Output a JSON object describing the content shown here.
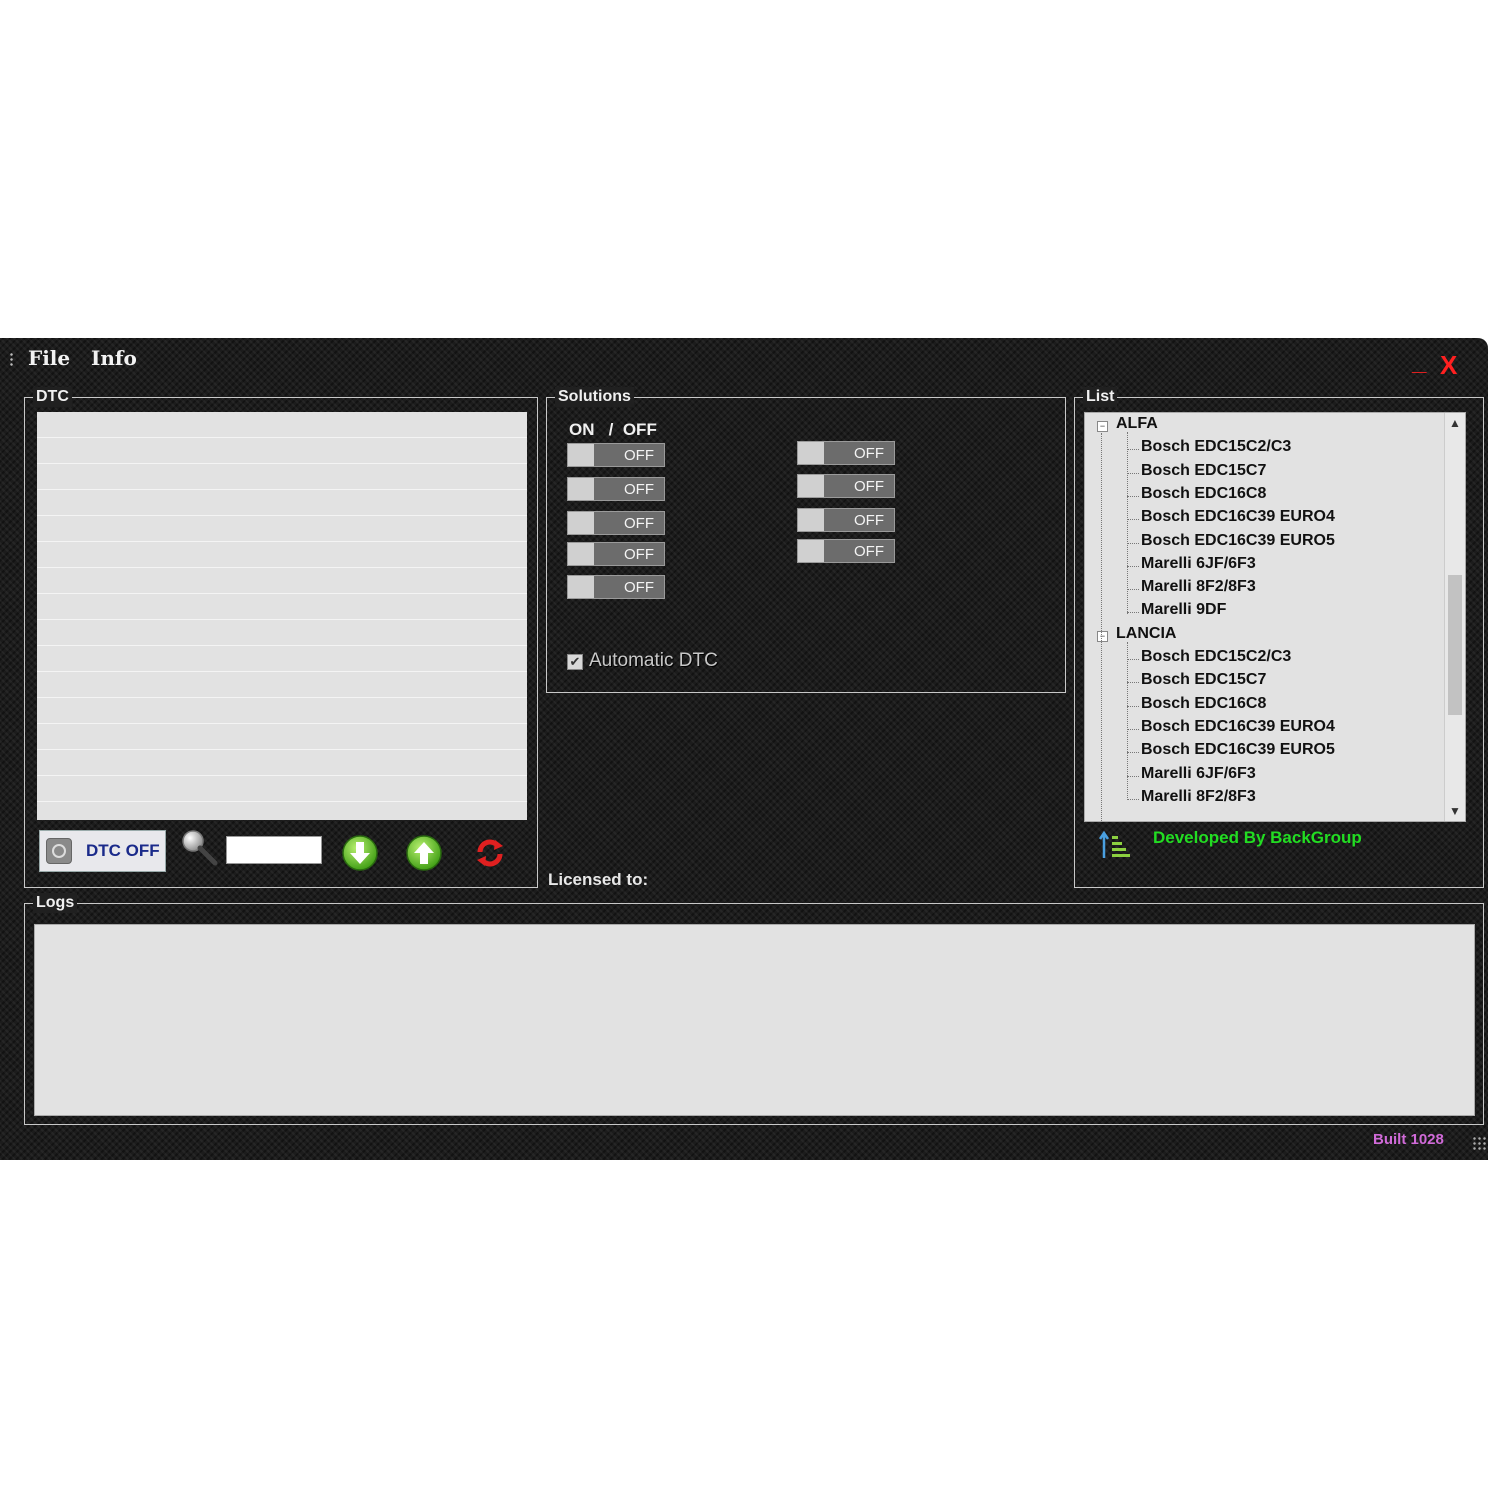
{
  "menu": {
    "file": "File",
    "info": "Info"
  },
  "window_controls": {
    "minimize": "_",
    "close": "X"
  },
  "dtc": {
    "title": "DTC",
    "off_button": "DTC OFF",
    "search_value": ""
  },
  "solutions": {
    "title": "Solutions",
    "on_off_header": "ON   /  OFF",
    "toggles_left": [
      "OFF",
      "OFF",
      "OFF",
      "OFF",
      "OFF"
    ],
    "toggles_right": [
      "OFF",
      "OFF",
      "OFF",
      "OFF"
    ],
    "automatic_dtc": "Automatic DTC",
    "automatic_dtc_checked": true
  },
  "licensed": "Licensed to:",
  "list": {
    "title": "List",
    "groups": [
      {
        "name": "ALFA",
        "items": [
          "Bosch EDC15C2/C3",
          "Bosch EDC15C7",
          "Bosch EDC16C8",
          "Bosch EDC16C39 EURO4",
          "Bosch EDC16C39 EURO5",
          "Marelli 6JF/6F3",
          "Marelli 8F2/8F3",
          "Marelli 9DF"
        ]
      },
      {
        "name": "LANCIA",
        "items": [
          "Bosch EDC15C2/C3",
          "Bosch EDC15C7",
          "Bosch EDC16C8",
          "Bosch EDC16C39 EURO4",
          "Bosch EDC16C39 EURO5",
          "Marelli 6JF/6F3",
          "Marelli 8F2/8F3"
        ]
      }
    ],
    "developed_by": "Developed By BackGroup"
  },
  "logs": {
    "title": "Logs"
  },
  "built": "Built 1028",
  "colors": {
    "accent_green": "#22dd22",
    "close_red": "#ff2020",
    "built_purple": "#d06ad8"
  }
}
